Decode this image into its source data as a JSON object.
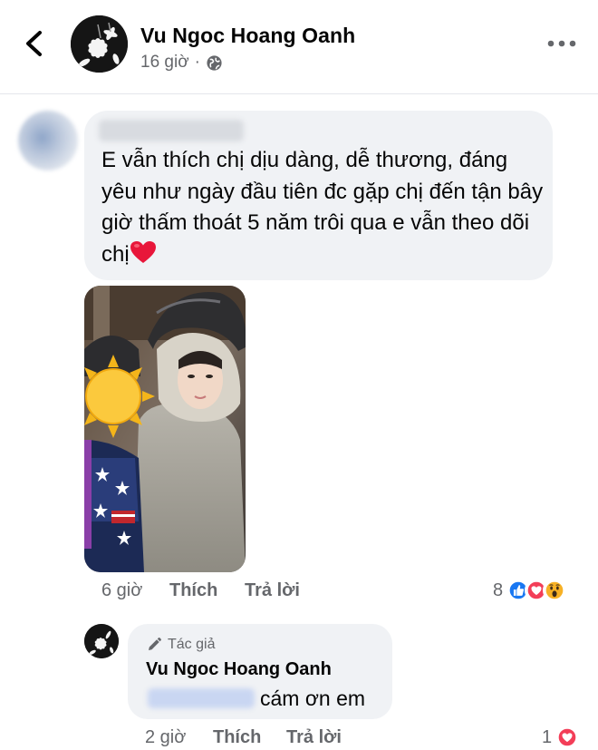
{
  "post": {
    "author": "Vu Ngoc Hoang Oanh",
    "time": "16 giờ",
    "privacy_icon": "globe-icon"
  },
  "comment": {
    "text": "E vẫn thích chị dịu dàng, dễ thương, đáng yêu như ngày đầu tiên đc gặp chị đến tận bây giờ thấm thoát 5 năm trôi qua e vẫn theo dõi chị",
    "emoji": "red-heart",
    "time": "6 giờ",
    "like_label": "Thích",
    "reply_label": "Trả lời",
    "reaction_count": "8",
    "reactions": [
      "like-reaction-icon",
      "love-reaction-icon",
      "wow-reaction-icon"
    ]
  },
  "reply": {
    "badge": "Tác giả",
    "author": "Vu Ngoc Hoang Oanh",
    "text": "cám ơn em",
    "time": "2 giờ",
    "like_label": "Thích",
    "reply_label": "Trả lời",
    "reaction_count": "1",
    "reactions": [
      "love-reaction-icon"
    ]
  },
  "colors": {
    "bubble": "#f0f2f5",
    "secondary_text": "#65676b",
    "like_blue": "#1877f2",
    "love_red": "#f33e58",
    "wow_yellow": "#f7b125"
  }
}
